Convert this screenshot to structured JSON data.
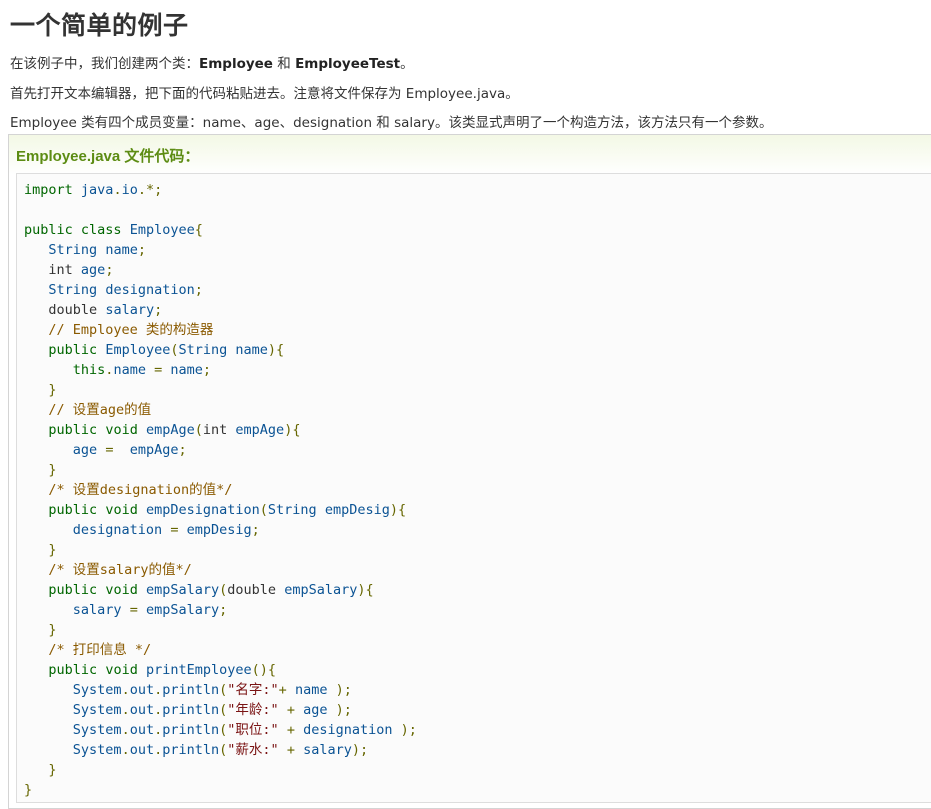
{
  "heading": "一个简单的例子",
  "paragraphs": {
    "p1_prefix": "在该例子中，我们创建两个类：",
    "p1_class1": "Employee",
    "p1_and": " 和 ",
    "p1_class2": "EmployeeTest",
    "p1_suffix": "。",
    "p2": "首先打开文本编辑器，把下面的代码粘贴进去。注意将文件保存为 Employee.java。",
    "p3": "Employee 类有四个成员变量：name、age、designation 和 salary。该类显式声明了一个构造方法，该方法只有一个参数。"
  },
  "example": {
    "title": "Employee.java 文件代码：",
    "code_lines": [
      "import java.io.*;",
      "",
      "public class Employee{",
      "   String name;",
      "   int age;",
      "   String designation;",
      "   double salary;",
      "   // Employee 类的构造器",
      "   public Employee(String name){",
      "      this.name = name;",
      "   }",
      "   // 设置age的值",
      "   public void empAge(int empAge){",
      "      age =  empAge;",
      "   }",
      "   /* 设置designation的值*/",
      "   public void empDesignation(String empDesig){",
      "      designation = empDesig;",
      "   }",
      "   /* 设置salary的值*/",
      "   public void empSalary(double empSalary){",
      "      salary = empSalary;",
      "   }",
      "   /* 打印信息 */",
      "   public void printEmployee(){",
      "      System.out.println(\"名字:\"+ name );",
      "      System.out.println(\"年龄:\" + age );",
      "      System.out.println(\"职位:\" + designation );",
      "      System.out.println(\"薪水:\" + salary);",
      "   }",
      "}"
    ]
  },
  "colors": {
    "keyword": "#006600",
    "identifier": "#0b5394",
    "comment": "#8a5a00",
    "string": "#7a1313",
    "title": "#5c8c13"
  }
}
